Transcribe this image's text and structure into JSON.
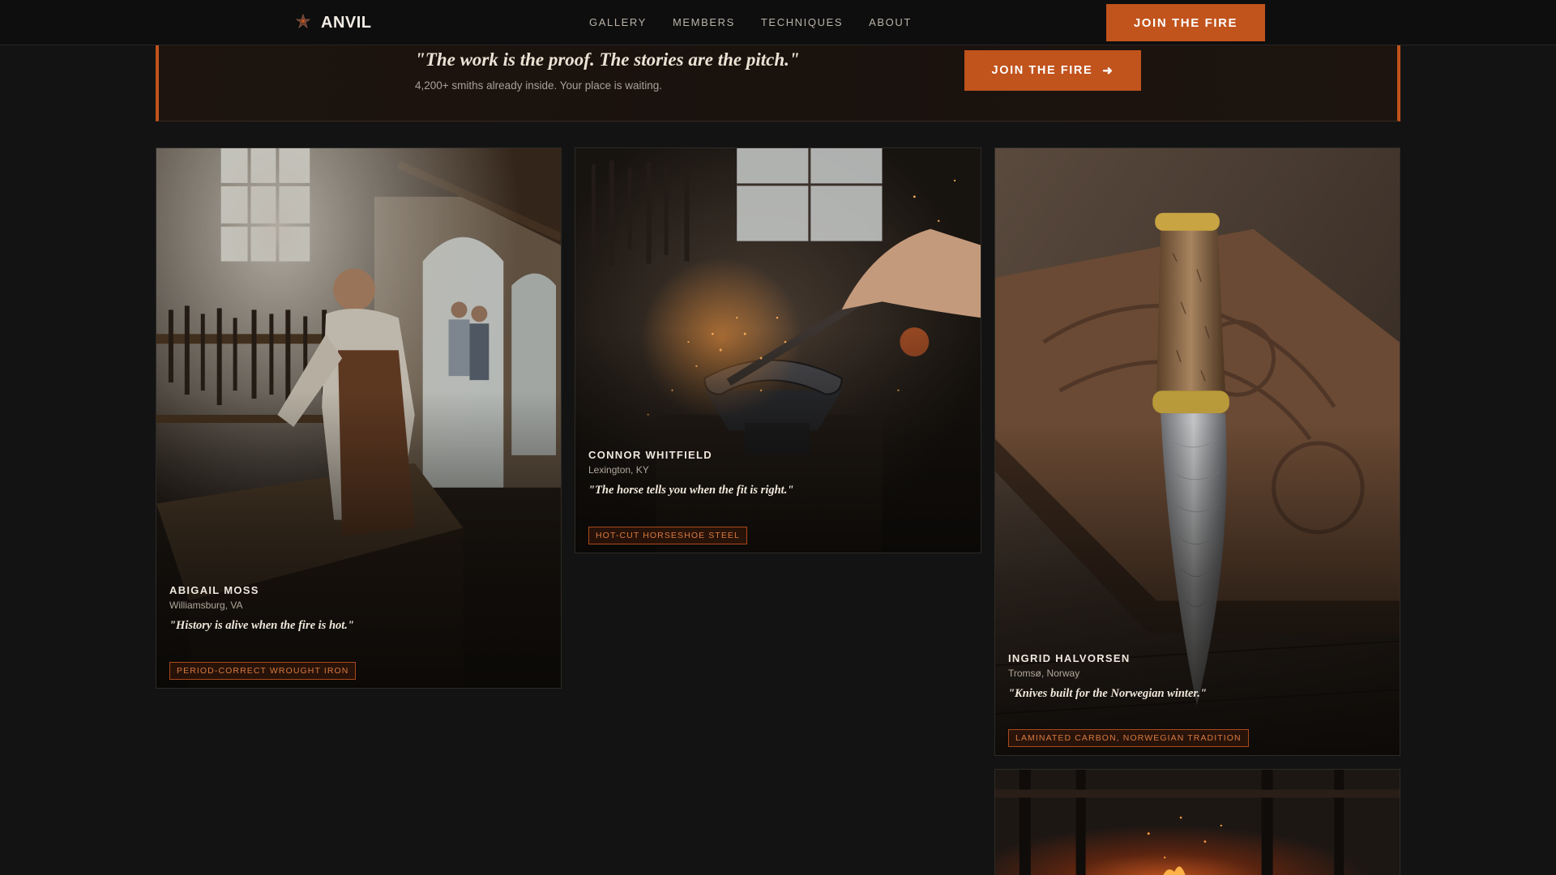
{
  "nav": {
    "brand": "ANVIL",
    "links": [
      "GALLERY",
      "MEMBERS",
      "TECHNIQUES",
      "ABOUT"
    ],
    "cta_label": "JOIN THE FIRE",
    "accent": "#c1531c"
  },
  "banner": {
    "quote": "\"The work is the proof. The stories are the pitch.\"",
    "subtext": "4,200+ smiths already inside. Your place is waiting.",
    "cta_label": "JOIN THE FIRE",
    "cta_icon": "arrow-right-icon"
  },
  "cards": [
    {
      "name": "ABIGAIL MOSS",
      "location": "Williamsburg, VA",
      "quote": "\"History is alive when the fire is hot.\"",
      "tag": "PERIOD-CORRECT WROUGHT IRON",
      "image": "smith-at-workbench"
    },
    {
      "name": "CONNOR WHITFIELD",
      "location": "Lexington, KY",
      "quote": "\"The horse tells you when the fit is right.\"",
      "tag": "HOT-CUT HORSESHOE STEEL",
      "image": "horseshoe-on-anvil-sparks"
    },
    {
      "name": "INGRID HALVORSEN",
      "location": "Tromsø, Norway",
      "quote": "\"Knives built for the Norwegian winter.\"",
      "tag": "LAMINATED CARBON, NORWEGIAN TRADITION",
      "image": "damascus-knife-on-carved-book"
    },
    {
      "image": "forge-fire-workshop"
    }
  ]
}
